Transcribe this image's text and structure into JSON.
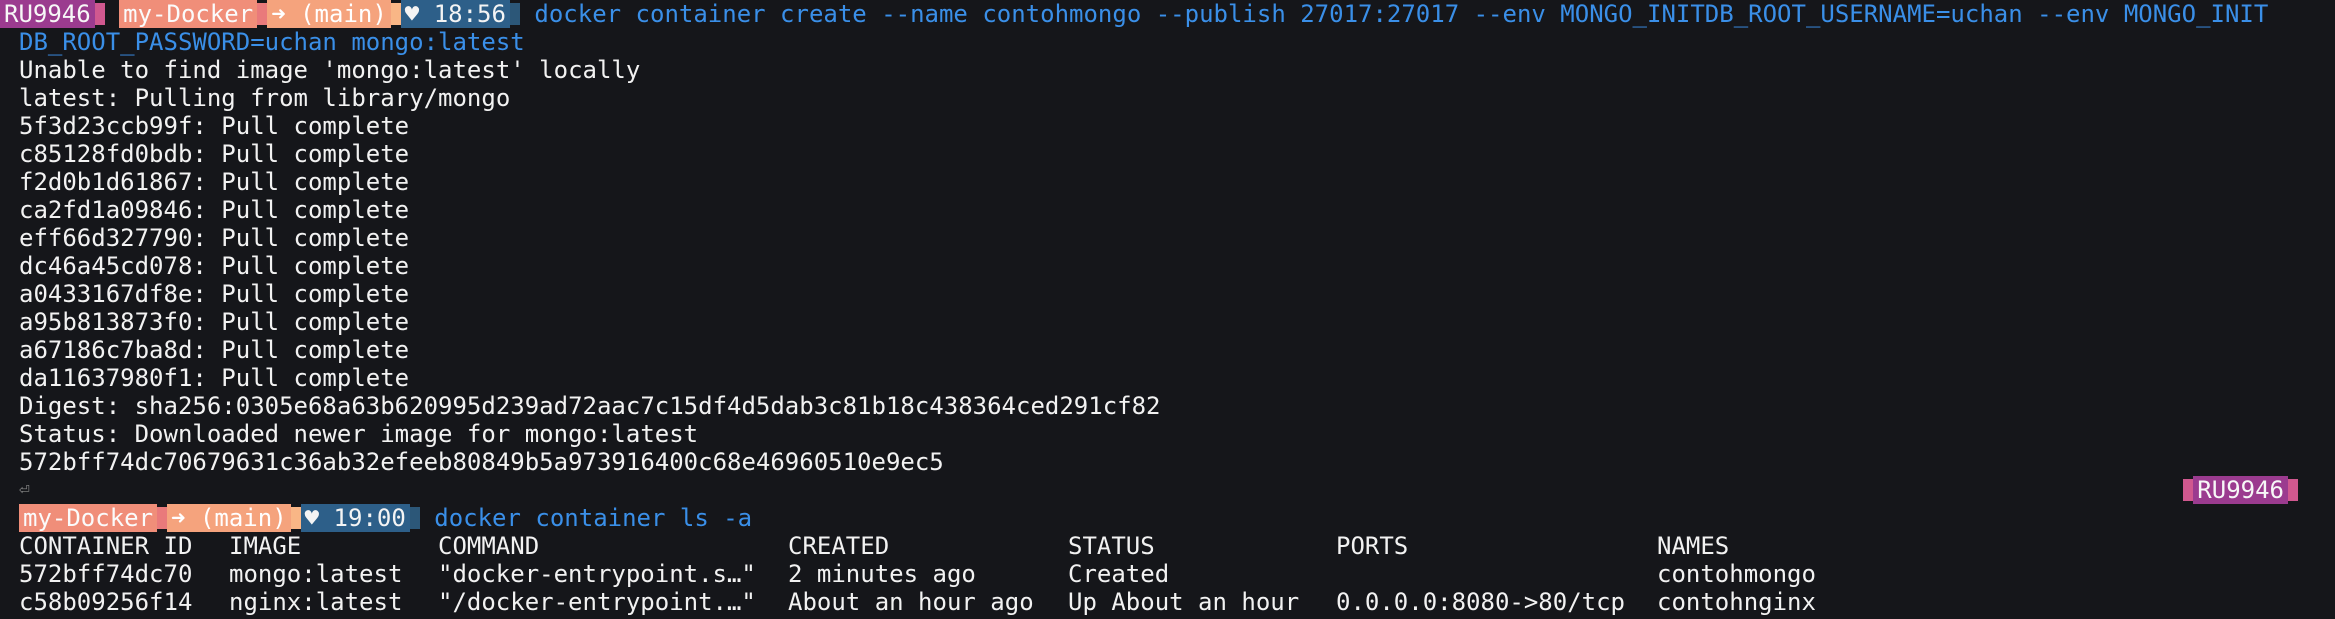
{
  "prompt1": {
    "glyph": "",
    "host": "RU9946",
    "dir": "my-Docker",
    "git": "➜ (main)",
    "time": "♥ 18:56",
    "command_line1": "docker container create --name contohmongo --publish 27017:27017 --env MONGO_INITDB_ROOT_USERNAME=uchan --env MONGO_INIT",
    "command_line2": "DB_ROOT_PASSWORD=uchan mongo:latest"
  },
  "output": [
    "Unable to find image 'mongo:latest' locally",
    "latest: Pulling from library/mongo",
    "5f3d23ccb99f: Pull complete",
    "c85128fd0bdb: Pull complete",
    "f2d0b1d61867: Pull complete",
    "ca2fd1a09846: Pull complete",
    "eff66d327790: Pull complete",
    "dc46a45cd078: Pull complete",
    "a0433167df8e: Pull complete",
    "a95b813873f0: Pull complete",
    "a67186c7ba8d: Pull complete",
    "da11637980f1: Pull complete",
    "Digest: sha256:0305e68a63b620995d239ad72aac7c15df4d5dab3c81b18c438364ced291cf82",
    "Status: Downloaded newer image for mongo:latest",
    "572bff74dc70679631c36ab32efeeb80849b5a973916400c68e46960510e9ec5"
  ],
  "return_mark": "⏎",
  "right_prompt": {
    "host": "RU9946"
  },
  "prompt2": {
    "dir": "my-Docker",
    "git": "➜ (main)",
    "time": "♥ 19:00",
    "command": "docker container ls -a"
  },
  "table": {
    "headers": [
      "CONTAINER ID",
      "IMAGE",
      "COMMAND",
      "CREATED",
      "STATUS",
      "PORTS",
      "NAMES"
    ],
    "rows": [
      [
        "572bff74dc70",
        "mongo:latest",
        "\"docker-entrypoint.s…\"",
        "2 minutes ago",
        "Created",
        "",
        "contohmongo"
      ],
      [
        "c58b09256f14",
        "nginx:latest",
        "\"/docker-entrypoint.…\"",
        "About an hour ago",
        "Up About an hour",
        "0.0.0.0:8080->80/tcp",
        "contohnginx"
      ]
    ]
  }
}
